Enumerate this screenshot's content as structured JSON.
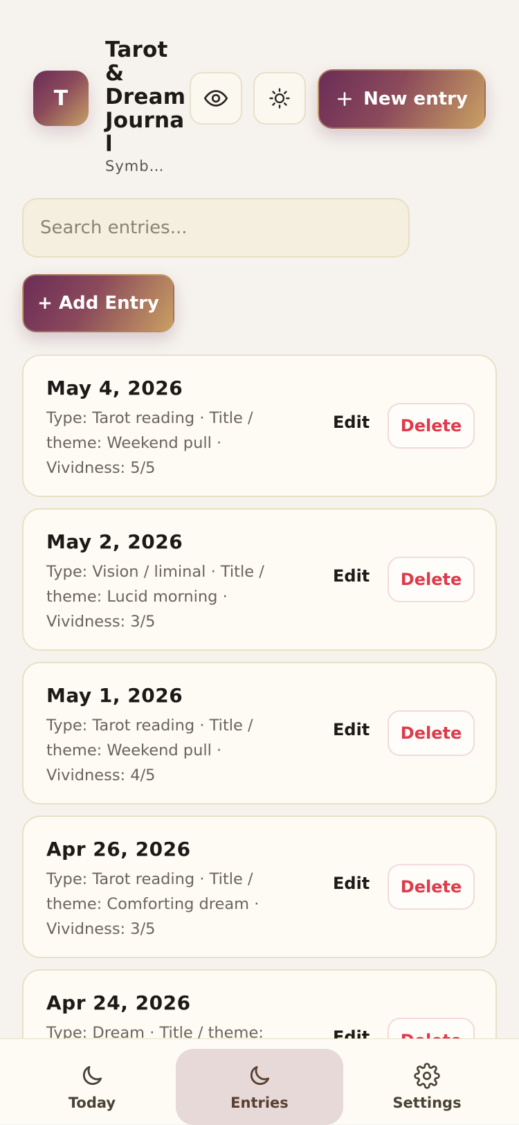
{
  "header": {
    "logo_letter": "T",
    "app_title": "Tarot & Dream Journal",
    "app_subtitle": "Symbo…",
    "new_entry_label": "New entry"
  },
  "search": {
    "placeholder": "Search entries..."
  },
  "add_entry_label": "+ Add Entry",
  "entries": [
    {
      "date": "May 4, 2026",
      "meta": "Type: Tarot reading · Title / theme: Weekend pull · Vividness: 5/5",
      "edit": "Edit",
      "delete": "Delete"
    },
    {
      "date": "May 2, 2026",
      "meta": "Type: Vision / liminal · Title / theme: Lucid morning · Vividness: 3/5",
      "edit": "Edit",
      "delete": "Delete"
    },
    {
      "date": "May 1, 2026",
      "meta": "Type: Tarot reading · Title / theme: Weekend pull · Vividness: 4/5",
      "edit": "Edit",
      "delete": "Delete"
    },
    {
      "date": "Apr 26, 2026",
      "meta": "Type: Tarot reading · Title / theme: Comforting dream · Vividness: 3/5",
      "edit": "Edit",
      "delete": "Delete"
    },
    {
      "date": "Apr 24, 2026",
      "meta": "Type: Dream · Title / theme:",
      "edit": "Edit",
      "delete": "Delete"
    }
  ],
  "nav": {
    "today": "Today",
    "entries": "Entries",
    "settings": "Settings"
  },
  "icons": {
    "theme_toggle": "eye-icon",
    "brightness": "sun-icon",
    "today": "moon-icon",
    "entries": "moon-icon",
    "settings": "gear-icon"
  },
  "colors": {
    "accent_start": "#6b2d57",
    "accent_end": "#c9a063",
    "delete_red": "#e0394b",
    "nav_active_bg": "#e6d9d8"
  }
}
